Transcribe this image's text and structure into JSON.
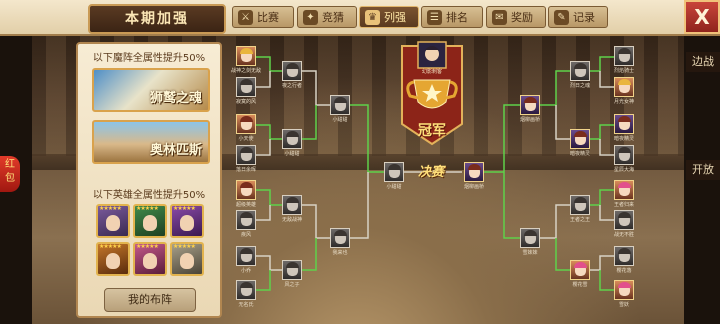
{
  "header": {
    "title": "本期加强",
    "tabs": [
      {
        "label": "比赛",
        "icon": "swords-icon",
        "active": false
      },
      {
        "label": "竞猜",
        "icon": "guess-icon",
        "active": false
      },
      {
        "label": "列强",
        "icon": "trophy-icon",
        "active": true
      },
      {
        "label": "排名",
        "icon": "rank-icon",
        "active": false
      },
      {
        "label": "奖励",
        "icon": "reward-icon",
        "active": false
      },
      {
        "label": "记录",
        "icon": "record-icon",
        "active": false
      }
    ],
    "close_label": "X"
  },
  "side": {
    "red_packet": [
      "红",
      "包"
    ],
    "partial_labels": [
      "边战",
      "开放"
    ]
  },
  "panel": {
    "formation_bonus_text": "以下魔阵全属性提升50%",
    "formations": [
      "狮鹫之魂",
      "奥林匹斯"
    ],
    "hero_bonus_text": "以下英雄全属性提升50%",
    "heroes": [
      {
        "stars": "★★★★★",
        "icon": "hero-portrait-icon"
      },
      {
        "stars": "★★★★★",
        "icon": "hero-portrait-icon"
      },
      {
        "stars": "★★★★★",
        "icon": "hero-portrait-icon"
      },
      {
        "stars": "★★★★★",
        "icon": "hero-portrait-icon"
      },
      {
        "stars": "★★★★★",
        "icon": "hero-portrait-icon"
      },
      {
        "stars": "★★★★★",
        "icon": "hero-portrait-icon"
      }
    ],
    "formation_button": "我的布阵"
  },
  "bracket": {
    "champion_label": "冠军",
    "champion_name": "幻影刺客",
    "final_label": "决赛",
    "left_round1": [
      "战神之剑无敌",
      "寂寞的风",
      "小天使",
      "落日余晖",
      "超级英雄",
      "疾风",
      "小乔",
      "无名氏"
    ],
    "left_round2": [
      "夜之行者",
      "小甜甜",
      "无敌战神",
      "风之子"
    ],
    "left_round3": [
      "小甜甜",
      "我来也"
    ],
    "left_semi": "小甜甜",
    "right_round1": [
      "烈焰骑士",
      "月光女神",
      "暗夜精灵",
      "星辰大海",
      "王者归来",
      "战无不胜",
      "樱花落",
      "雪妖"
    ],
    "right_round2": [
      "烈日之魂",
      "暗夜精灵",
      "王者之王",
      "樱花雪"
    ],
    "right_round3": [
      "烟柳画桥",
      "雪妹妹"
    ],
    "right_semi": "烟柳画桥"
  }
}
